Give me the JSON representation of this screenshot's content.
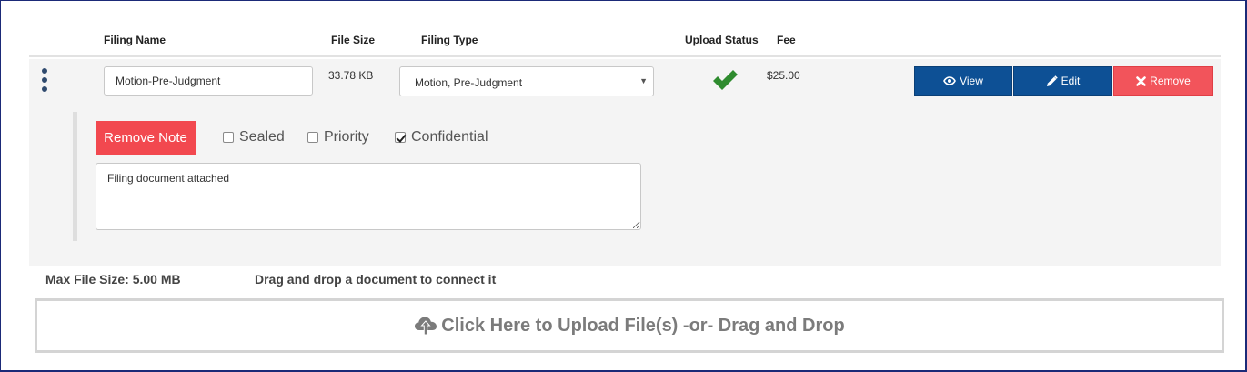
{
  "table": {
    "headers": {
      "filing_name": "Filing Name",
      "file_size": "File Size",
      "filing_type": "Filing Type",
      "upload_status": "Upload Status",
      "fee": "Fee"
    },
    "row": {
      "filing_name_value": "Motion-Pre-Judgment",
      "file_size": "33.78 KB",
      "filing_type_selected": "Motion, Pre-Judgment",
      "upload_status_icon": "checkmark-icon",
      "fee": "$25.00",
      "actions": {
        "view_label": "View",
        "edit_label": "Edit",
        "remove_label": "Remove"
      }
    }
  },
  "note": {
    "remove_note_label": "Remove Note",
    "sealed_label": "Sealed",
    "sealed_checked": false,
    "priority_label": "Priority",
    "priority_checked": false,
    "confidential_label": "Confidential",
    "confidential_checked": true,
    "text": "Filing document attached"
  },
  "upload": {
    "max_file_size": "Max File Size: 5.00 MB",
    "drag_hint": "Drag and drop a document to connect it",
    "dropzone_label": "Click Here to Upload File(s) -or- Drag and Drop",
    "dropzone_icon": "cloud-upload-icon"
  },
  "colors": {
    "primary_button": "#0d5095",
    "danger_button": "#f2545b",
    "success_check": "#2e8b2e",
    "frame_border": "#1b2a78"
  }
}
